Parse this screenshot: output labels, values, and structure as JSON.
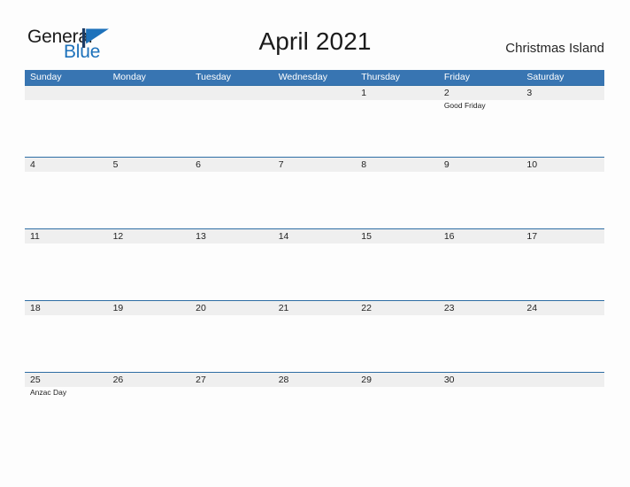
{
  "brand": {
    "logo_text_1": "General",
    "logo_text_2": "Blue",
    "logo_icon": "flag-triangle-icon",
    "accent_color": "#1e72bb"
  },
  "header": {
    "title": "April 2021",
    "location": "Christmas Island"
  },
  "calendar": {
    "header_bg_color": "#3875b2",
    "row_border_color": "#2e6da4",
    "band_bg_color": "#efefef",
    "weekdays": [
      "Sunday",
      "Monday",
      "Tuesday",
      "Wednesday",
      "Thursday",
      "Friday",
      "Saturday"
    ],
    "weeks": [
      [
        {
          "num": "",
          "event": ""
        },
        {
          "num": "",
          "event": ""
        },
        {
          "num": "",
          "event": ""
        },
        {
          "num": "",
          "event": ""
        },
        {
          "num": "1",
          "event": ""
        },
        {
          "num": "2",
          "event": "Good Friday"
        },
        {
          "num": "3",
          "event": ""
        }
      ],
      [
        {
          "num": "4",
          "event": ""
        },
        {
          "num": "5",
          "event": ""
        },
        {
          "num": "6",
          "event": ""
        },
        {
          "num": "7",
          "event": ""
        },
        {
          "num": "8",
          "event": ""
        },
        {
          "num": "9",
          "event": ""
        },
        {
          "num": "10",
          "event": ""
        }
      ],
      [
        {
          "num": "11",
          "event": ""
        },
        {
          "num": "12",
          "event": ""
        },
        {
          "num": "13",
          "event": ""
        },
        {
          "num": "14",
          "event": ""
        },
        {
          "num": "15",
          "event": ""
        },
        {
          "num": "16",
          "event": ""
        },
        {
          "num": "17",
          "event": ""
        }
      ],
      [
        {
          "num": "18",
          "event": ""
        },
        {
          "num": "19",
          "event": ""
        },
        {
          "num": "20",
          "event": ""
        },
        {
          "num": "21",
          "event": ""
        },
        {
          "num": "22",
          "event": ""
        },
        {
          "num": "23",
          "event": ""
        },
        {
          "num": "24",
          "event": ""
        }
      ],
      [
        {
          "num": "25",
          "event": "Anzac Day"
        },
        {
          "num": "26",
          "event": ""
        },
        {
          "num": "27",
          "event": ""
        },
        {
          "num": "28",
          "event": ""
        },
        {
          "num": "29",
          "event": ""
        },
        {
          "num": "30",
          "event": ""
        },
        {
          "num": "",
          "event": ""
        }
      ]
    ]
  }
}
